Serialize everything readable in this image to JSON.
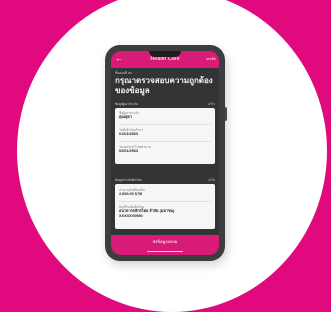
{
  "app": {
    "title": "Health Care",
    "appbar_right": "ยกเลิก"
  },
  "header": {
    "subtitle": "ขั้นตอนที่ 3/3",
    "title": "กรุณาตรวจสอบความถูกต้องของข้อมูล"
  },
  "sections": [
    {
      "heading": "ข้อมูลผู้เอาประกัน",
      "edit_label": "แก้ไข",
      "rows": [
        {
          "label": "ชื่อผู้เอาประกัน",
          "value": "คุณสุดา"
        },
        {
          "label": "วันที่เข้ารับบริการ",
          "value": "01/01/2563"
        },
        {
          "label": "วันออกจากโรงพยาบาล",
          "value": "02/01/2563"
        }
      ]
    },
    {
      "heading": "ข้อมูลการเบิกสินไหม",
      "edit_label": "แก้ไข",
      "rows": [
        {
          "label": "จำนวนเงินที่ขอเบิก",
          "value": "2,000.00 บาท"
        },
        {
          "label": "บัญชีรับเงินสินไหม",
          "value": "ธนาคารกสิกรไทย จำกัด (มหาชน)\nXXXXXX0980"
        }
      ]
    }
  ],
  "cta": {
    "label": "ส่งข้อมูลเคลม"
  },
  "colors": {
    "brand": "#d81b76",
    "background": "#e0097e",
    "screen": "#333436"
  }
}
